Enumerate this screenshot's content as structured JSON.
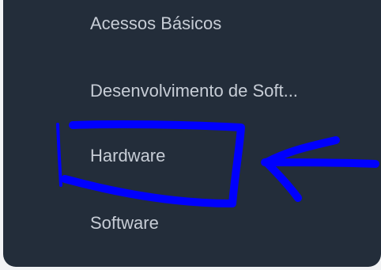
{
  "menu": {
    "items": [
      {
        "label": "Acessos Básicos"
      },
      {
        "label": "Desenvolvimento de Soft..."
      },
      {
        "label": "Hardware"
      },
      {
        "label": "Software"
      }
    ]
  },
  "annotation": {
    "color": "#0000ff",
    "highlighted_item": "Hardware"
  }
}
